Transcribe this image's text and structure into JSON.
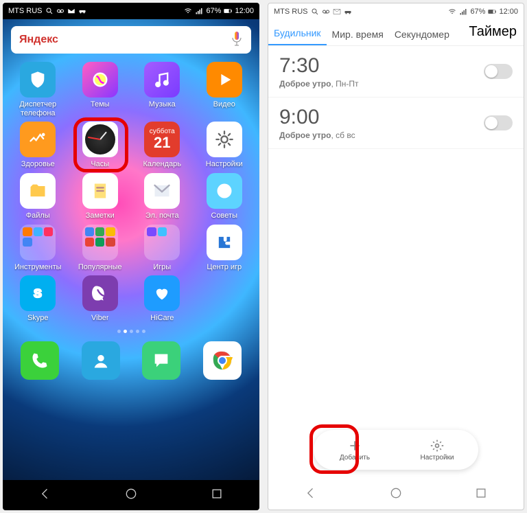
{
  "statusbar": {
    "carrier": "MTS RUS",
    "battery": "67%",
    "time": "12:00"
  },
  "home": {
    "search_label": "Яндекс",
    "apps": [
      {
        "name": "Диспетчер телефона",
        "bg": "#2aa8e0",
        "glyph": "shield"
      },
      {
        "name": "Темы",
        "bg": "linear-gradient(135deg,#ff5ec3,#8a36ff)",
        "glyph": "themes"
      },
      {
        "name": "Музыка",
        "bg": "linear-gradient(135deg,#a45cff,#7a3cff)",
        "glyph": "music"
      },
      {
        "name": "Видео",
        "bg": "#ff8a00",
        "glyph": "play"
      },
      {
        "name": "Здоровье",
        "bg": "#ff9a1e",
        "glyph": "heart"
      },
      {
        "name": "Часы",
        "bg": "#000",
        "glyph": "clock",
        "highlighted": true
      },
      {
        "name": "Календарь",
        "bg": "#e23c2c",
        "glyph": "calendar",
        "cal_dow": "суббота",
        "cal_day": "21"
      },
      {
        "name": "Настройки",
        "bg": "#ffffff",
        "glyph": "gear"
      },
      {
        "name": "Файлы",
        "bg": "#ffffff",
        "glyph": "folder"
      },
      {
        "name": "Заметки",
        "bg": "#ffffff",
        "glyph": "notes"
      },
      {
        "name": "Эл. почта",
        "bg": "#ffffff",
        "glyph": "mail"
      },
      {
        "name": "Советы",
        "bg": "#5dd3ff",
        "glyph": "info"
      },
      {
        "name": "Инструменты",
        "bg": "folder",
        "glyph": "folder-group",
        "minis": [
          "#ff7a00",
          "#3fb3ff",
          "#ff3060",
          "#4285f4"
        ]
      },
      {
        "name": "Популярные",
        "bg": "folder",
        "glyph": "folder-group",
        "minis": [
          "#4285f4",
          "#34a853",
          "#fbbc05",
          "#ea4335",
          "#0f9d58",
          "#db4437"
        ]
      },
      {
        "name": "Игры",
        "bg": "folder",
        "glyph": "folder-group",
        "minis": [
          "#7a4aff",
          "#3fc1ff"
        ]
      },
      {
        "name": "Центр игр",
        "bg": "#ffffff",
        "glyph": "puzzle"
      },
      {
        "name": "Skype",
        "bg": "#00aff0",
        "glyph": "skype"
      },
      {
        "name": "Viber",
        "bg": "#7d3daf",
        "glyph": "viber"
      },
      {
        "name": "HiCare",
        "bg": "#1e9cff",
        "glyph": "care"
      }
    ],
    "dock": [
      {
        "name": "Телефон",
        "bg": "#3bd13b",
        "glyph": "phone"
      },
      {
        "name": "Контакты",
        "bg": "#2aa8e0",
        "glyph": "contact"
      },
      {
        "name": "Сообщения",
        "bg": "#3bd17a",
        "glyph": "msg"
      },
      {
        "name": "Chrome",
        "bg": "#ffffff",
        "glyph": "chrome"
      }
    ],
    "page_indicator": {
      "count": 5,
      "active": 1
    }
  },
  "clock": {
    "tabs": [
      {
        "label": "Будильник",
        "active": true
      },
      {
        "label": "Мир. время"
      },
      {
        "label": "Секундомер"
      },
      {
        "label": "Таймер",
        "big": true
      }
    ],
    "alarms": [
      {
        "time": "7:30",
        "label": "Доброе утро",
        "days": "Пн-Пт",
        "on": false
      },
      {
        "time": "9:00",
        "label": "Доброе утро",
        "days": "сб вс",
        "on": false
      }
    ],
    "bottom": {
      "add_label": "Добавить",
      "settings_label": "Настройки",
      "highlighted": true
    }
  }
}
